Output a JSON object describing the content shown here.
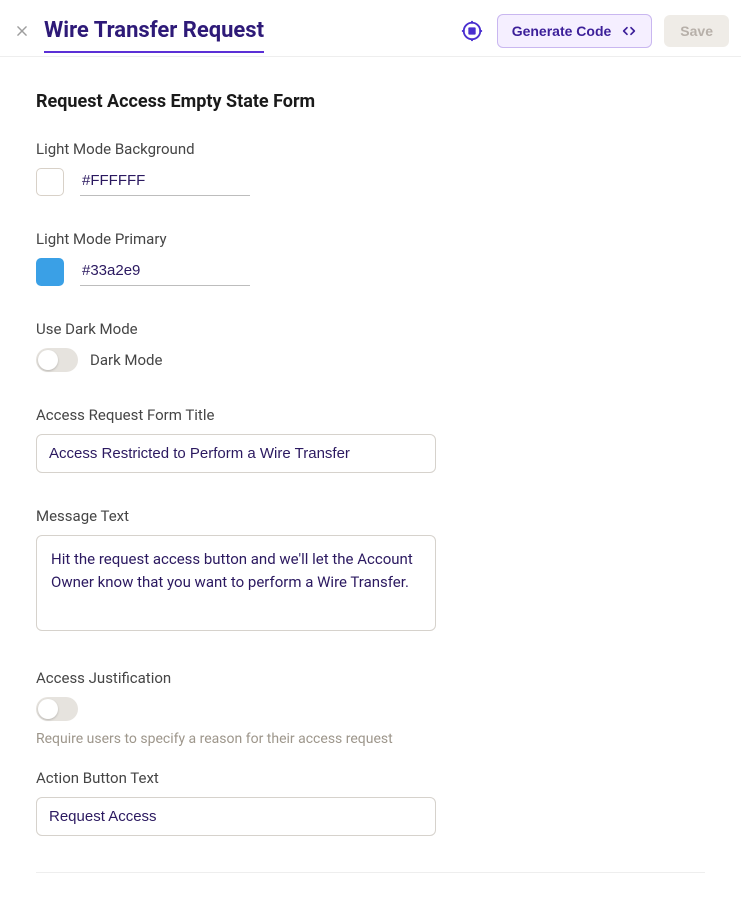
{
  "header": {
    "title": "Wire Transfer Request",
    "generate_label": "Generate Code",
    "save_label": "Save"
  },
  "form": {
    "section_title": "Request Access Empty State Form",
    "light_bg": {
      "label": "Light Mode Background",
      "value": "#FFFFFF",
      "swatch_color": "#FFFFFF"
    },
    "light_primary": {
      "label": "Light Mode Primary",
      "value": "#33a2e9",
      "swatch_color": "#33a2e9"
    },
    "dark_mode": {
      "label": "Use Dark Mode",
      "toggle_label": "Dark Mode",
      "enabled": false
    },
    "form_title": {
      "label": "Access Request Form Title",
      "value": "Access Restricted to Perform a Wire Transfer"
    },
    "message": {
      "label": "Message Text",
      "value": "Hit the request access button and we'll let the Account Owner know that you want to perform a Wire Transfer."
    },
    "justification": {
      "label": "Access Justification",
      "help": "Require users to specify a reason for their access request",
      "enabled": false
    },
    "action_button": {
      "label": "Action Button Text",
      "value": "Request Access"
    }
  }
}
